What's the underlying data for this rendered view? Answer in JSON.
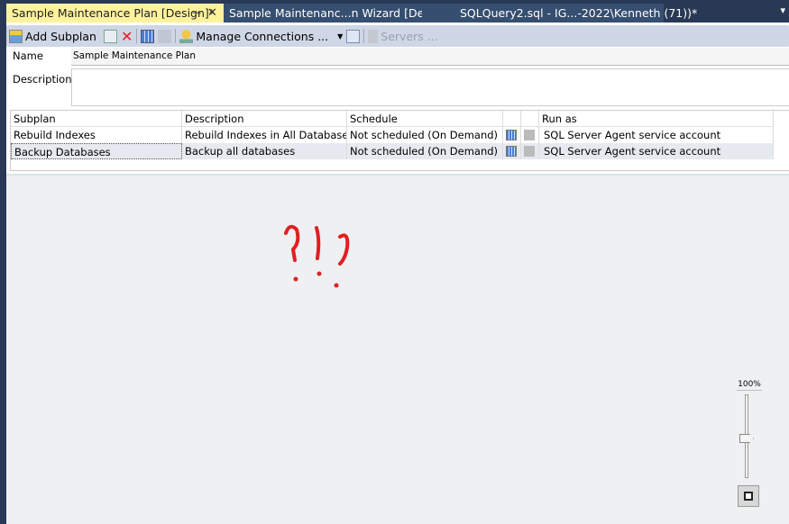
{
  "tabs": [
    {
      "label": "Sample Maintenance Plan [Design]*",
      "active": true
    },
    {
      "label": "Sample Maintenanc...n Wizard [Design]",
      "active": false
    },
    {
      "label": "SQLQuery2.sql - IG...-2022\\Kenneth (71))*",
      "active": false
    }
  ],
  "toolbar": {
    "add_subplan": "Add Subplan",
    "manage_connections": "Manage Connections ...",
    "servers": "Servers ..."
  },
  "form": {
    "name_label": "Name",
    "name_value": "Sample Maintenance Plan",
    "description_label": "Description",
    "description_value": ""
  },
  "grid": {
    "headers": [
      "Subplan",
      "Description",
      "Schedule",
      "",
      "",
      "Run as"
    ],
    "rows": [
      {
        "subplan": "Rebuild Indexes",
        "description": "Rebuild Indexes in All Databases",
        "schedule": "Not scheduled (On Demand)",
        "run_as": "SQL Server Agent service account"
      },
      {
        "subplan": "Backup Databases",
        "description": "Backup all databases",
        "schedule": "Not scheduled (On Demand)",
        "run_as": "SQL Server Agent service account",
        "selected": true
      }
    ]
  },
  "canvas": {
    "annotation": "?!?",
    "annotation_color": "#e02020",
    "zoom_level": "100%"
  },
  "colors": {
    "tab_active": "#fff29d",
    "chrome": "#293955",
    "toolbar": "#cfd6e5"
  }
}
